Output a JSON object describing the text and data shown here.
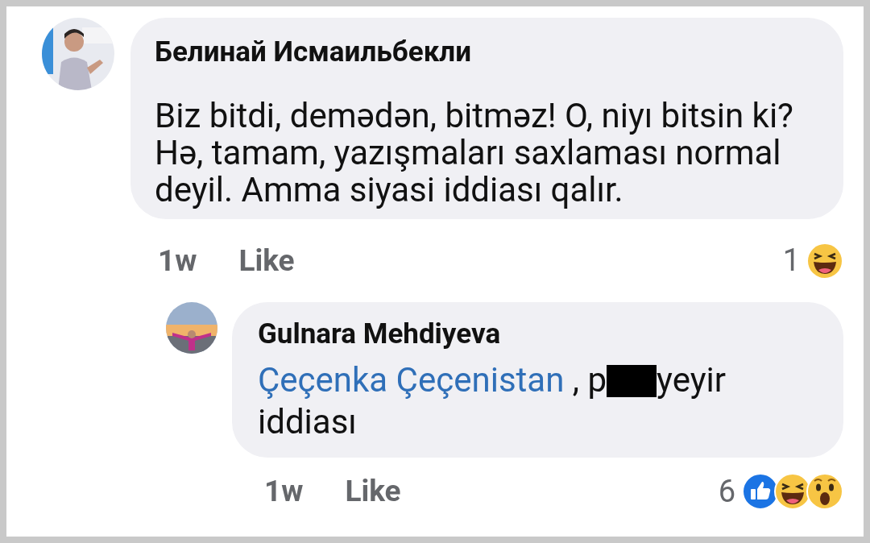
{
  "comments": [
    {
      "author": "Белинай Исмаильбекли",
      "avatar": {
        "kind": "picture"
      },
      "kind": "comment",
      "message": [
        {
          "kind": "text",
          "text": "Biz bitdi, demədən, bitməz! O, niyı bitsin ki? Hə, tamam, yazışmaları saxlaması normal deyil. Amma siyasi iddiası qalır."
        }
      ],
      "time": "1w",
      "like_label": "Like",
      "reaction_count": "1",
      "reactions": [
        {
          "kind": "haha"
        }
      ]
    },
    {
      "author": "Gulnara Mehdiyeva",
      "avatar": {
        "kind": "picture"
      },
      "kind": "reply",
      "message": [
        {
          "kind": "mention",
          "text": "Çeçenka Çeçenistan"
        },
        {
          "kind": "text",
          "text": " , p"
        },
        {
          "kind": "redacted"
        },
        {
          "kind": "text",
          "text": "yeyir iddiası"
        }
      ],
      "time": "1w",
      "like_label": "Like",
      "reaction_count": "6",
      "reactions": [
        {
          "kind": "like"
        },
        {
          "kind": "haha"
        },
        {
          "kind": "wow"
        }
      ]
    }
  ]
}
